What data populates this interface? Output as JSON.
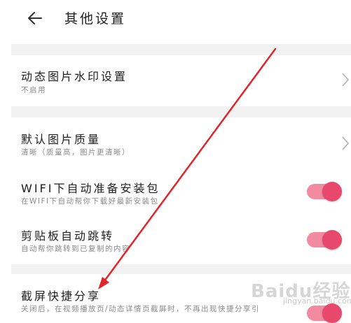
{
  "header": {
    "title": "其他设置",
    "back_icon": "arrow-left-icon"
  },
  "settings": {
    "watermark": {
      "title": "动态图片水印设置",
      "subtitle": "不启用"
    },
    "image_quality": {
      "title": "默认图片质量",
      "subtitle": "清晰（质量高，图片更清晰）"
    },
    "wifi_prepare": {
      "title": "WIFI下自动准备安装包",
      "subtitle": "在WIFI下自动帮你下载好最新安装包",
      "enabled": true
    },
    "clipboard_jump": {
      "title": "剪贴板自动跳转",
      "subtitle": "自动帮你跳转到已复制的内容",
      "enabled": true
    },
    "screenshot_share": {
      "title": "截屏快捷分享",
      "subtitle": "关闭后，在视频播放页/动态详情页截屏时，不再出现快捷分享引",
      "enabled": true
    }
  },
  "colors": {
    "toggle_track": "#f28aa0",
    "toggle_knob": "#e8486c",
    "annotation_arrow": "#e0262b"
  },
  "watermark_brand": {
    "logo": "Baidu经验",
    "url": "jingyan.baidu.com"
  }
}
